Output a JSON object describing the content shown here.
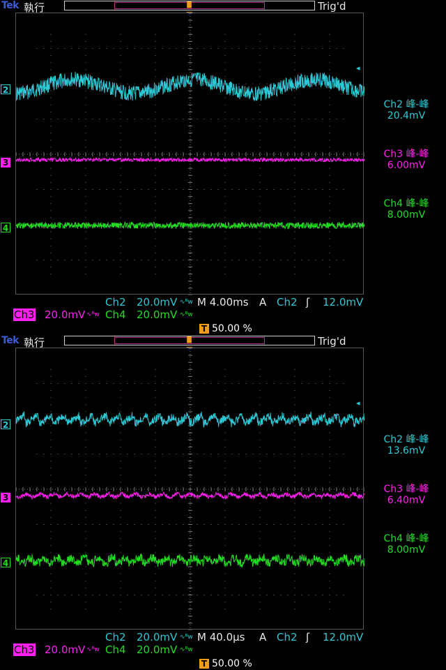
{
  "panels": [
    {
      "brand": "Tek",
      "run_state": "執行",
      "trigger_status": "Trig'd",
      "channels": [
        {
          "id": "2",
          "label": "Ch2",
          "color": "#2ec9d6",
          "meas_name": "Ch2 峰-峰",
          "meas_value": "20.4mV"
        },
        {
          "id": "3",
          "label": "Ch3",
          "color": "#ff1ff0",
          "meas_name": "Ch3 峰-峰",
          "meas_value": "6.00mV"
        },
        {
          "id": "4",
          "label": "Ch4",
          "color": "#22dd22",
          "meas_name": "Ch4 峰-峰",
          "meas_value": "8.00mV"
        }
      ],
      "ch2_scale": "20.0mV",
      "ch3_scale": "20.0mV",
      "ch4_scale": "20.0mV",
      "bw_icon": "∿ᴮw",
      "timebase": "M 4.00ms",
      "trig_source_prefix": "A",
      "trig_source": "Ch2",
      "trig_slope": "ʃ",
      "trig_level": "12.0mV",
      "trig_position_label": "T",
      "trig_position": "50.00 %"
    },
    {
      "brand": "Tek",
      "run_state": "執行",
      "trigger_status": "Trig'd",
      "channels": [
        {
          "id": "2",
          "label": "Ch2",
          "color": "#2ec9d6",
          "meas_name": "Ch2 峰-峰",
          "meas_value": "13.6mV"
        },
        {
          "id": "3",
          "label": "Ch3",
          "color": "#ff1ff0",
          "meas_name": "Ch3 峰-峰",
          "meas_value": "6.40mV"
        },
        {
          "id": "4",
          "label": "Ch4",
          "color": "#22dd22",
          "meas_name": "Ch4 峰-峰",
          "meas_value": "8.00mV"
        }
      ],
      "ch2_scale": "20.0mV",
      "ch3_scale": "20.0mV",
      "ch4_scale": "20.0mV",
      "bw_icon": "∿ᴮw",
      "timebase": "M 40.0µs",
      "trig_source_prefix": "A",
      "trig_source": "Ch2",
      "trig_slope": "ʃ",
      "trig_level": "12.0mV",
      "trig_position_label": "T",
      "trig_position": "50.00 %"
    }
  ],
  "colors": {
    "background": "#000000",
    "graticule": "#7a7a7a",
    "ch2": "#2ec9d6",
    "ch3": "#ff1ff0",
    "ch4": "#22dd22",
    "trigger_marker": "#f39c1a",
    "text": "#e8e8e8",
    "brand": "#3a5dd8",
    "record_view": "#c03090"
  },
  "icons": {
    "trigger_marker": "trigger-position-marker-icon",
    "trigger_level": "trigger-level-arrow-icon",
    "bandwidth_limit": "bandwidth-limit-icon",
    "rising_edge": "rising-edge-icon"
  }
}
